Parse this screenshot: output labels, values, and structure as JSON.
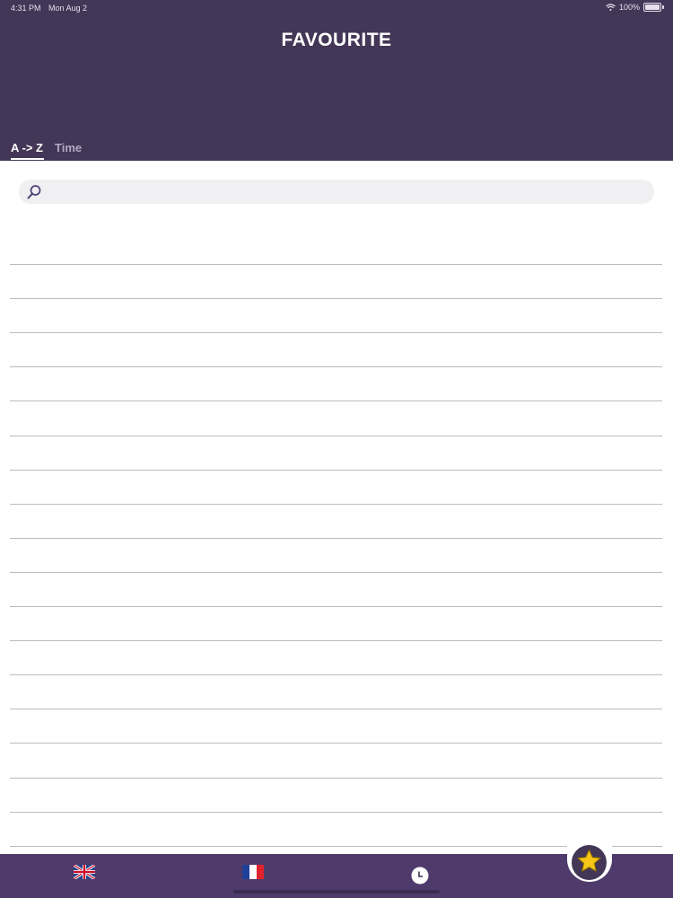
{
  "status_bar": {
    "time": "4:31 PM",
    "date": "Mon Aug 2",
    "battery": "100%"
  },
  "header": {
    "title": "FAVOURITE"
  },
  "sort_tabs": [
    {
      "label": "A -> Z",
      "active": true
    },
    {
      "label": "Time",
      "active": false
    }
  ],
  "search": {
    "placeholder": "",
    "icon": "search-icon"
  },
  "favourites_list": {
    "row_count": 18
  },
  "tab_bar": {
    "items": [
      {
        "icon": "uk-flag-icon"
      },
      {
        "icon": "france-flag-icon"
      },
      {
        "icon": "clock-icon"
      },
      {
        "icon": "star-icon",
        "active": true
      }
    ]
  },
  "colors": {
    "header_bg": "#433656",
    "tab_bar_bg": "#4f3b6b",
    "star": "#f5c518"
  }
}
